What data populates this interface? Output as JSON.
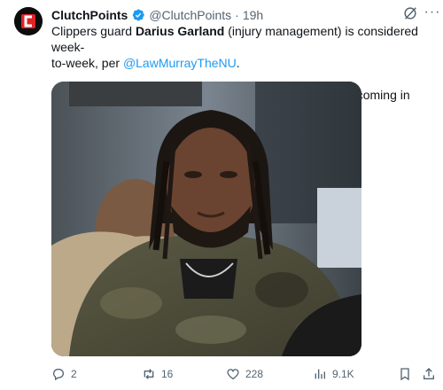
{
  "tweet": {
    "author_name": "ClutchPoints",
    "handle": "@ClutchPoints",
    "separator": "·",
    "time": "19h",
    "text": {
      "line1_a": "Clippers guard ",
      "line1_bold": "Darius Garland",
      "line1_b": " (injury management) is considered week-",
      "line2_a": "to-week, per ",
      "mention": "@LawMurrayTheNU",
      "line2_b": ".",
      "line3": "He is expected to play this season, with his debut likely coming in March."
    },
    "media_alt": "Photo of a man with long braided hair wearing a camouflage jacket at a courtside seat",
    "icons": {
      "avatar": "clutchpoints-logo",
      "verified": "verified-badge-icon",
      "grok": "grok-icon",
      "more": "more-icon"
    },
    "colors": {
      "link": "#1d9bf0",
      "muted": "#536471",
      "logo_red": "#e0242a"
    }
  },
  "actions": {
    "reply_count": "2",
    "repost_count": "16",
    "like_count": "228",
    "views_count": "9.1K"
  }
}
